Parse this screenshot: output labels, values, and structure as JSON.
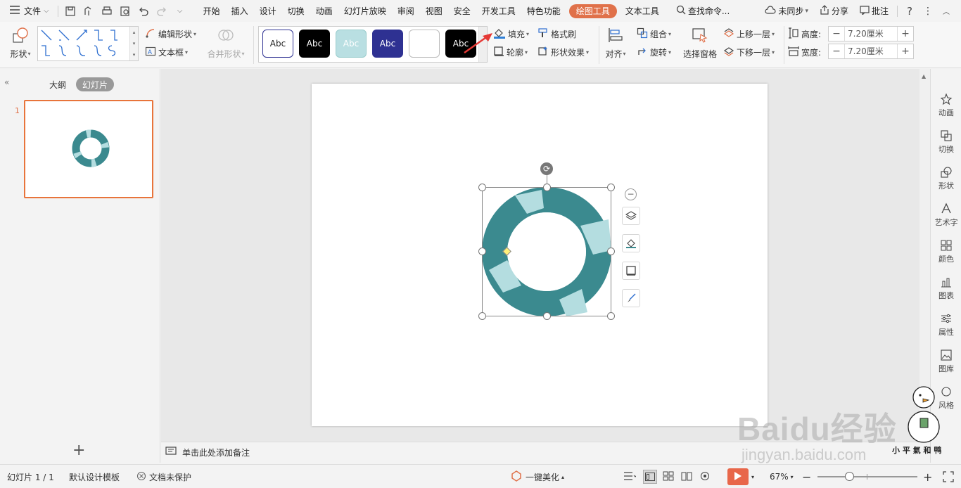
{
  "menubar": {
    "file": "文件",
    "tabs": [
      "开始",
      "插入",
      "设计",
      "切换",
      "动画",
      "幻灯片放映",
      "审阅",
      "视图",
      "安全",
      "开发工具",
      "特色功能"
    ],
    "active_tab": "绘图工具",
    "text_tools": "文本工具",
    "search": "查找命令...",
    "sync": "未同步",
    "share": "分享",
    "comment": "批注"
  },
  "ribbon": {
    "shape": "形状",
    "edit_shape": "编辑形状",
    "text_box": "文本框",
    "merge_shape": "合并形状",
    "style_samples": [
      "Abc",
      "Abc",
      "Abc",
      "Abc",
      "",
      "Abc"
    ],
    "fill": "填充",
    "format_painter": "格式刷",
    "outline": "轮廓",
    "shape_effects": "形状效果",
    "align": "对齐",
    "group": "组合",
    "rotate": "旋转",
    "selection_pane": "选择窗格",
    "bring_forward": "上移一层",
    "send_backward": "下移一层",
    "height_label": "高度:",
    "height_value": "7.20厘米",
    "width_label": "宽度:",
    "width_value": "7.20厘米"
  },
  "colors": {
    "accent": "#e0714a",
    "ring_dark": "#3b8a8f",
    "ring_light": "#b4dde0",
    "style_dark_blue": "#2e3192",
    "style_light_teal": "#b9dfe2"
  },
  "left_panel": {
    "outline_tab": "大纲",
    "slides_tab": "幻灯片",
    "slide_number": "1"
  },
  "notes": {
    "placeholder": "单击此处添加备注"
  },
  "right_panel": {
    "items": [
      "动画",
      "切换",
      "形状",
      "艺术字",
      "颜色",
      "图表",
      "属性",
      "图库",
      "风格"
    ]
  },
  "status": {
    "slide_counter": "幻灯片 1 / 1",
    "template": "默认设计模板",
    "protection": "文档未保护",
    "beautify": "一键美化",
    "zoom": "67%"
  },
  "watermark": {
    "brand": "Baidu经验",
    "url": "jingyan.baidu.com",
    "stamp": "小 平 氣 和 鸭"
  }
}
